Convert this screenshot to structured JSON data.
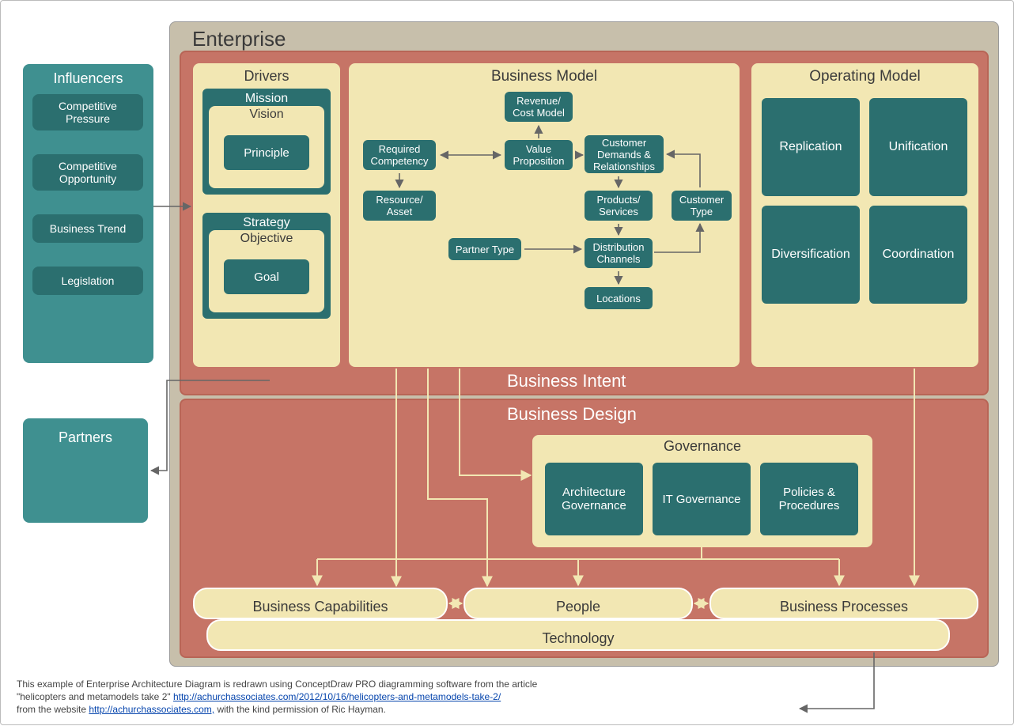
{
  "enterprise_title": "Enterprise",
  "influencers": {
    "title": "Influencers",
    "items": [
      "Competitive Pressure",
      "Competitive Opportunity",
      "Business Trend",
      "Legislation"
    ]
  },
  "partners": "Partners",
  "drivers": {
    "title": "Drivers",
    "mission": "Mission",
    "vision": "Vision",
    "principle": "Principle",
    "strategy": "Strategy",
    "objective": "Objective",
    "goal": "Goal"
  },
  "business_model": {
    "title": "Business Model",
    "revenue": "Revenue/\nCost Model",
    "required": "Required\nCompetency",
    "value": "Value\nProposition",
    "demands": "Customer\nDemands &\nRelationships",
    "resource": "Resource/\nAsset",
    "products": "Products/\nServices",
    "ctype": "Customer\nType",
    "partner_type": "Partner Type",
    "dist": "Distribution\nChannels",
    "locations": "Locations"
  },
  "operating_model": {
    "title": "Operating Model",
    "items": [
      "Replication",
      "Unification",
      "Diversification",
      "Coordination"
    ]
  },
  "business_intent": "Business Intent",
  "business_design": "Business Design",
  "governance": {
    "title": "Governance",
    "items": [
      "Architecture\nGovernance",
      "IT Governance",
      "Policies &\nProcedures"
    ]
  },
  "capabilities": "Business Capabilities",
  "people": "People",
  "processes": "Business Processes",
  "technology": "Technology",
  "footer": {
    "line1a": "This example of Enterprise Architecture Diagram is redrawn using ConceptDraw PRO diagramming software  from the article",
    "line2a": "\"helicopters and metamodels take 2\" ",
    "url1": "http://achurchassociates.com/2012/10/16/helicopters-and-metamodels-take-2/",
    "line3a": "from the website ",
    "url2": "http://achurchassociates.com,",
    "line3b": "  with the kind permission of Ric Hayman."
  }
}
